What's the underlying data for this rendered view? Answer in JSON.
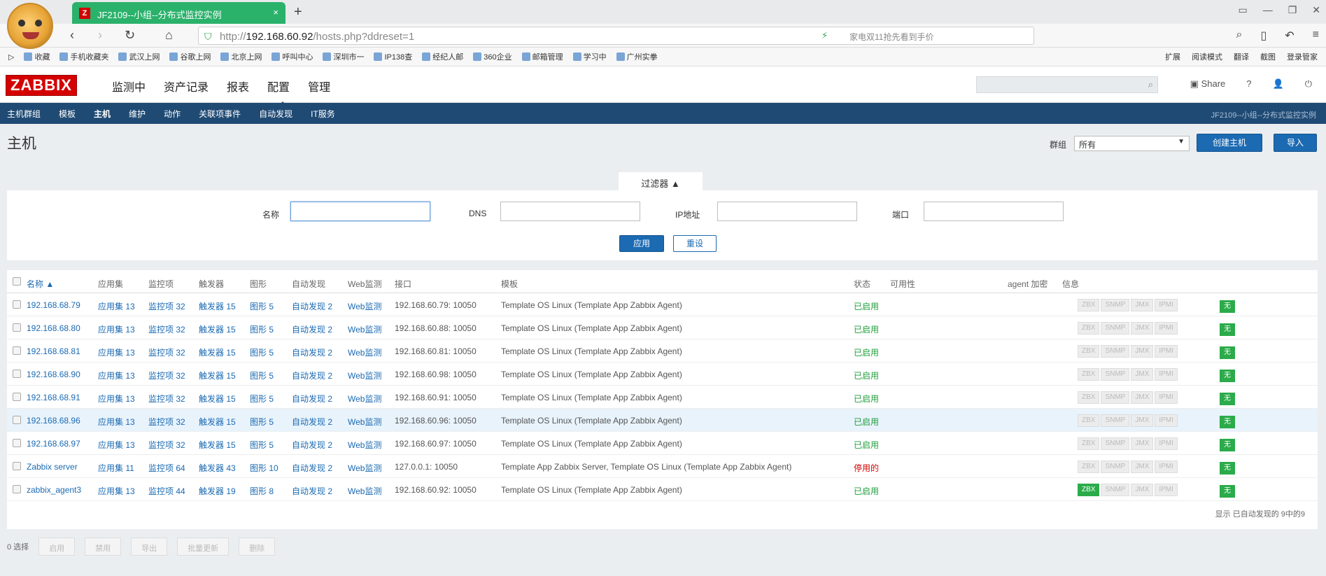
{
  "browser": {
    "tab_title": "JF2109--小组--分布式监控实例",
    "tab_icon_letter": "Z",
    "tab_close": "×",
    "new_tab": "+",
    "url_prefix": "http://",
    "url_host": "192.168.60.92",
    "url_path": "/hosts.php?ddreset=1",
    "url_right_text": "家电双11抢先看到手价",
    "bookmarks": [
      "收藏",
      "手机收藏夹",
      "武汉上网",
      "谷歌上网",
      "北京上网",
      "呼叫中心",
      "深圳市一",
      "IP138查",
      "经纪人邮",
      "360企业",
      "邮箱管理",
      "学习中",
      "广州实拳"
    ],
    "bookmark_right": [
      "扩展",
      "阅读模式",
      "翻译",
      "截图",
      "登录管家"
    ]
  },
  "zabbix": {
    "logo": "ZABBIX",
    "menu": [
      "监测中",
      "资产记录",
      "报表",
      "配置",
      "管理"
    ],
    "menu_selected_index": 3,
    "share": "Share",
    "help": "?",
    "submenu": [
      "主机群组",
      "模板",
      "主机",
      "维护",
      "动作",
      "关联项事件",
      "自动发现",
      "IT服务"
    ],
    "submenu_right": "JF2109--小组--分布式监控实例",
    "page_title": "主机",
    "group_label": "群组",
    "group_value": "所有",
    "create_host": "创建主机",
    "import": "导入",
    "filter": {
      "tab_label": "过滤器 ▲",
      "name_label": "名称",
      "dns_label": "DNS",
      "ip_label": "IP地址",
      "port_label": "端口",
      "name_value": "",
      "apply": "应用",
      "reset": "重设"
    },
    "table": {
      "headers": [
        "名称 ▲",
        "应用集",
        "监控项",
        "触发器",
        "图形",
        "自动发现",
        "Web监测",
        "接口",
        "模板",
        "状态",
        "可用性",
        "agent 加密",
        "信息"
      ],
      "rows": [
        {
          "name": "192.168.68.79",
          "apps": "应用集 13",
          "items": "监控项 32",
          "triggers": "触发器 15",
          "graphs": "图形 5",
          "discovery": "自动发现 2",
          "web": "Web监测",
          "iface": "192.168.60.79: 10050",
          "templates": "Template OS Linux (Template App Zabbix Agent)",
          "status": "已启用",
          "zbx_green": false,
          "hl": false
        },
        {
          "name": "192.168.68.80",
          "apps": "应用集 13",
          "items": "监控项 32",
          "triggers": "触发器 15",
          "graphs": "图形 5",
          "discovery": "自动发现 2",
          "web": "Web监测",
          "iface": "192.168.60.88: 10050",
          "templates": "Template OS Linux (Template App Zabbix Agent)",
          "status": "已启用",
          "zbx_green": false,
          "hl": false
        },
        {
          "name": "192.168.68.81",
          "apps": "应用集 13",
          "items": "监控项 32",
          "triggers": "触发器 15",
          "graphs": "图形 5",
          "discovery": "自动发现 2",
          "web": "Web监测",
          "iface": "192.168.60.81: 10050",
          "templates": "Template OS Linux (Template App Zabbix Agent)",
          "status": "已启用",
          "zbx_green": false,
          "hl": false
        },
        {
          "name": "192.168.68.90",
          "apps": "应用集 13",
          "items": "监控项 32",
          "triggers": "触发器 15",
          "graphs": "图形 5",
          "discovery": "自动发现 2",
          "web": "Web监测",
          "iface": "192.168.60.98: 10050",
          "templates": "Template OS Linux (Template App Zabbix Agent)",
          "status": "已启用",
          "zbx_green": false,
          "hl": false
        },
        {
          "name": "192.168.68.91",
          "apps": "应用集 13",
          "items": "监控项 32",
          "triggers": "触发器 15",
          "graphs": "图形 5",
          "discovery": "自动发现 2",
          "web": "Web监测",
          "iface": "192.168.60.91: 10050",
          "templates": "Template OS Linux (Template App Zabbix Agent)",
          "status": "已启用",
          "zbx_green": false,
          "hl": false
        },
        {
          "name": "192.168.68.96",
          "apps": "应用集 13",
          "items": "监控项 32",
          "triggers": "触发器 15",
          "graphs": "图形 5",
          "discovery": "自动发现 2",
          "web": "Web监测",
          "iface": "192.168.60.96: 10050",
          "templates": "Template OS Linux (Template App Zabbix Agent)",
          "status": "已启用",
          "zbx_green": false,
          "hl": true
        },
        {
          "name": "192.168.68.97",
          "apps": "应用集 13",
          "items": "监控项 32",
          "triggers": "触发器 15",
          "graphs": "图形 5",
          "discovery": "自动发现 2",
          "web": "Web监测",
          "iface": "192.168.60.97: 10050",
          "templates": "Template OS Linux (Template App Zabbix Agent)",
          "status": "已启用",
          "zbx_green": false,
          "hl": false
        },
        {
          "name": "Zabbix server",
          "apps": "应用集 11",
          "items": "监控项 64",
          "triggers": "触发器 43",
          "graphs": "图形 10",
          "discovery": "自动发现 2",
          "web": "Web监测",
          "iface": "127.0.0.1: 10050",
          "templates": "Template App Zabbix Server, Template OS Linux (Template App Zabbix Agent)",
          "status": "停用的",
          "zbx_green": false,
          "hl": false
        },
        {
          "name": "zabbix_agent3",
          "apps": "应用集 13",
          "items": "监控项 44",
          "triggers": "触发器 19",
          "graphs": "图形 8",
          "discovery": "自动发现 2",
          "web": "Web监测",
          "iface": "192.168.60.92: 10050",
          "templates": "Template OS Linux (Template App Zabbix Agent)",
          "status": "已启用",
          "zbx_green": true,
          "hl": false
        }
      ],
      "avail_labels": [
        "ZBX",
        "SNMP",
        "JMX",
        "IPMI"
      ],
      "encryption": "无",
      "footer": "显示 已自动发现的 9中的9"
    },
    "bottom": {
      "selected": "0 选择",
      "buttons": [
        "启用",
        "禁用",
        "导出",
        "批量更新",
        "删除"
      ]
    }
  },
  "colors": {
    "zabbix_red": "#d40000",
    "nav_blue": "#1f4a74",
    "link_blue": "#1b6ab2",
    "ok_green": "#2bab4a",
    "tab_green": "#2ab26b"
  }
}
